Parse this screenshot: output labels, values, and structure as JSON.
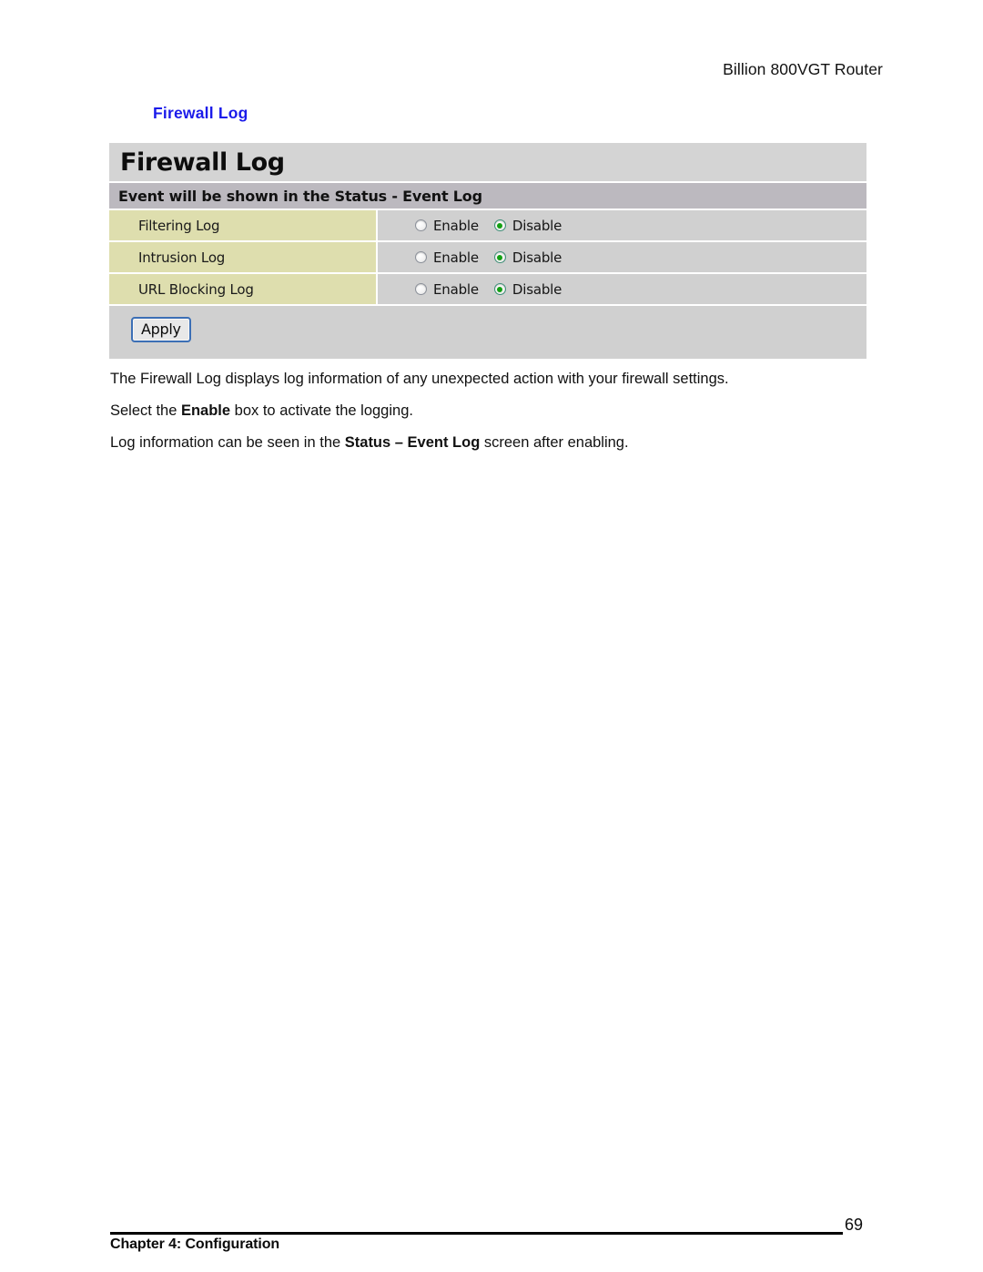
{
  "page": {
    "running_header": "Billion 800VGT Router",
    "section_heading": "Firewall Log",
    "heading_color": "#1b1bea"
  },
  "router_panel": {
    "title": "Firewall Log",
    "subtitle": "Event will be shown in the Status - Event Log",
    "rows": [
      {
        "label": "Filtering Log",
        "options": [
          {
            "label": "Enable",
            "selected": false
          },
          {
            "label": "Disable",
            "selected": true
          }
        ]
      },
      {
        "label": "Intrusion Log",
        "options": [
          {
            "label": "Enable",
            "selected": false
          },
          {
            "label": "Disable",
            "selected": true
          }
        ]
      },
      {
        "label": "URL Blocking Log",
        "options": [
          {
            "label": "Enable",
            "selected": false
          },
          {
            "label": "Disable",
            "selected": true
          }
        ]
      }
    ],
    "apply_label": "Apply",
    "colors": {
      "titlebar": "#d4d4d4",
      "subbar": "#bcb9bf",
      "label_cell": "#dedeae",
      "value_cell": "#d0d0d0",
      "radio_selected": "#13a013",
      "apply_border": "#3c6fb5"
    }
  },
  "body_copy": {
    "paragraph_1": {
      "part_1": "The Firewall Log displays log information of any unexpected action with your firewall settings."
    },
    "paragraph_2": {
      "part_1": "Select the ",
      "bold_1": "Enable",
      "part_2": " box to activate the logging."
    },
    "paragraph_3": {
      "part_1": "Log information can be seen in the ",
      "bold_1": "Status – Event Log",
      "part_2": " screen after enabling."
    }
  },
  "footer": {
    "chapter": "Chapter 4: Configuration",
    "page_number": "69"
  }
}
